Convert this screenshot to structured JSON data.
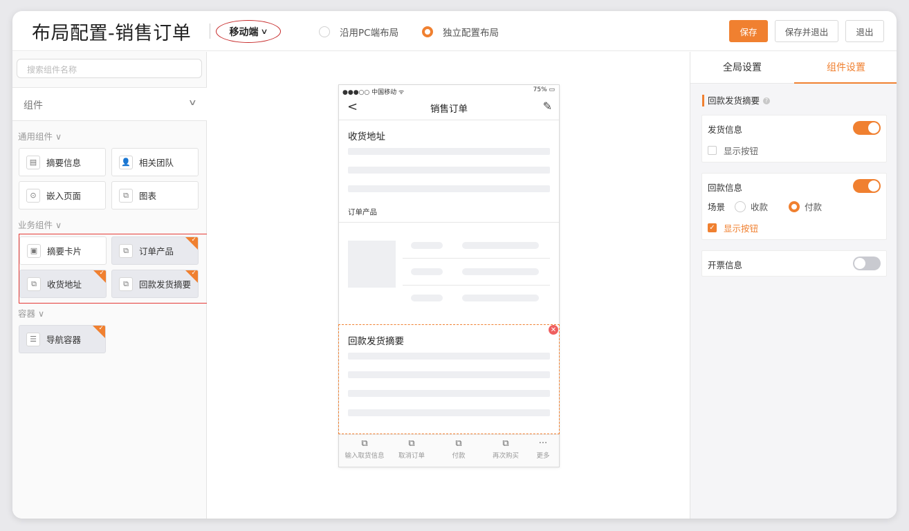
{
  "header": {
    "title": "布局配置-销售订单",
    "device": "移动端",
    "layout_options": [
      {
        "label": "沿用PC端布局",
        "selected": false
      },
      {
        "label": "独立配置布局",
        "selected": true
      }
    ],
    "buttons": {
      "save": "保存",
      "save_exit": "保存并退出",
      "exit": "退出"
    }
  },
  "left": {
    "search_placeholder": "搜索组件名称",
    "components_label": "组件",
    "groups": {
      "general": "通用组件",
      "business": "业务组件",
      "container": "容器"
    },
    "cards": {
      "summary_info": "摘要信息",
      "related_team": "相关团队",
      "embed_page": "嵌入页面",
      "chart": "图表",
      "summary_card": "摘要卡片",
      "order_products": "订单产品",
      "shipping_address": "收货地址",
      "payment_summary": "回款发货摘要",
      "nav_container": "导航容器"
    }
  },
  "phone": {
    "status_left": "●●●○○ 中国移动 ᯤ",
    "status_right": "75% ▭",
    "nav_title": "销售订单",
    "section1": "收货地址",
    "section2": "订单产品",
    "section3": "回款发货摘要",
    "tabs": [
      {
        "icon": "⧉",
        "label": "输入取货信息"
      },
      {
        "icon": "⧉",
        "label": "取消订单"
      },
      {
        "icon": "⧉",
        "label": "付款"
      },
      {
        "icon": "⧉",
        "label": "再次购买"
      },
      {
        "icon": "···",
        "label": "更多"
      }
    ]
  },
  "right": {
    "tabs": {
      "global": "全局设置",
      "component": "组件设置"
    },
    "active_tab": "组件设置",
    "section_title": "回款发货摘要",
    "shipping": {
      "name": "发货信息",
      "enabled": true,
      "show_button": "显示按钮",
      "show_button_checked": false
    },
    "payment": {
      "name": "回款信息",
      "enabled": true,
      "scene_label": "场景",
      "scene_options": [
        "收款",
        "付款"
      ],
      "scene_selected": "付款",
      "show_button": "显示按钮",
      "show_button_checked": true
    },
    "invoice": {
      "name": "开票信息",
      "enabled": false
    }
  },
  "colors": {
    "accent": "#f08030",
    "highlight_box": "#e53935"
  }
}
